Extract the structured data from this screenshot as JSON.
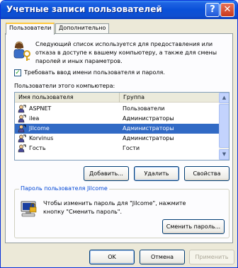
{
  "window": {
    "title": "Учетные записи пользователей",
    "help_glyph": "?",
    "close_glyph": "✕"
  },
  "tabs": [
    {
      "label": "Пользователи",
      "active": true
    },
    {
      "label": "Дополнительно",
      "active": false
    }
  ],
  "intro": {
    "line1": "Следующий список используется для предоставления или",
    "line2": "отказа в доступе к вашему компьютеру, а также для смены",
    "line3": "паролей и иных параметров."
  },
  "require_password": {
    "label": "Требовать ввод имени пользователя и пароля.",
    "checked": true,
    "check_glyph": "✓"
  },
  "users_section_label": "Пользователи этого компьютера:",
  "users_table": {
    "columns": [
      "Имя пользователя",
      "Группа"
    ],
    "rows": [
      {
        "name": "ASPNET",
        "group": "Пользователи",
        "selected": false
      },
      {
        "name": "ilea",
        "group": "Администраторы",
        "selected": false
      },
      {
        "name": "Jilcome",
        "group": "Администраторы",
        "selected": true
      },
      {
        "name": "Korvinus",
        "group": "Администраторы",
        "selected": false
      },
      {
        "name": "Гость",
        "group": "Гости",
        "selected": false
      }
    ],
    "scroll_up_glyph": "▲",
    "scroll_down_glyph": "▼"
  },
  "list_buttons": {
    "add": "Добавить...",
    "delete": "Удалить",
    "properties": "Свойства"
  },
  "password_group": {
    "title": "Пароль пользователя Jilcome",
    "line1": "Чтобы изменить пароль для \"Jilcome\", нажмите",
    "line2": "кнопку \"Сменить пароль\".",
    "change_button": "Сменить пароль..."
  },
  "dialog_buttons": {
    "ok": "OK",
    "cancel": "Отмена",
    "apply": "Применить"
  },
  "colors": {
    "selection": "#316ac5",
    "titlebar": "#0a50d8",
    "group_title": "#0046d5"
  }
}
